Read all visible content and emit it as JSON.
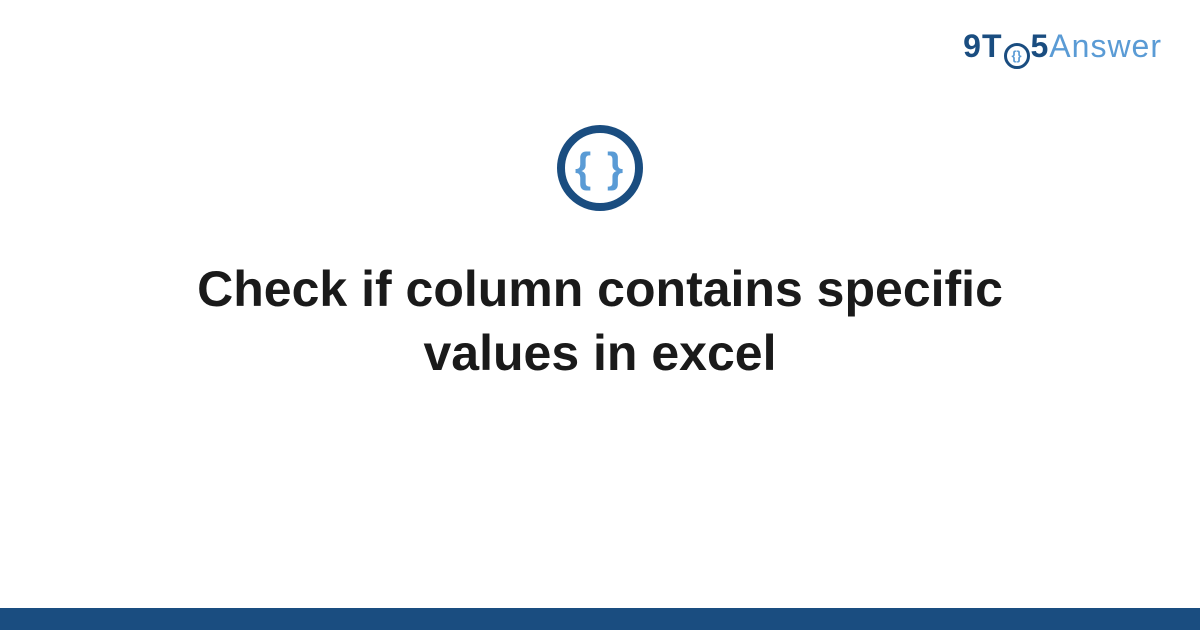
{
  "logo": {
    "part1": "9T",
    "braces": "{}",
    "part2": "5",
    "part3": "Answer"
  },
  "icon": {
    "braces": "{ }"
  },
  "title": "Check if column contains specific values in excel",
  "colors": {
    "primary": "#1a4d80",
    "accent": "#5a9bd5",
    "text": "#1a1a1a"
  }
}
